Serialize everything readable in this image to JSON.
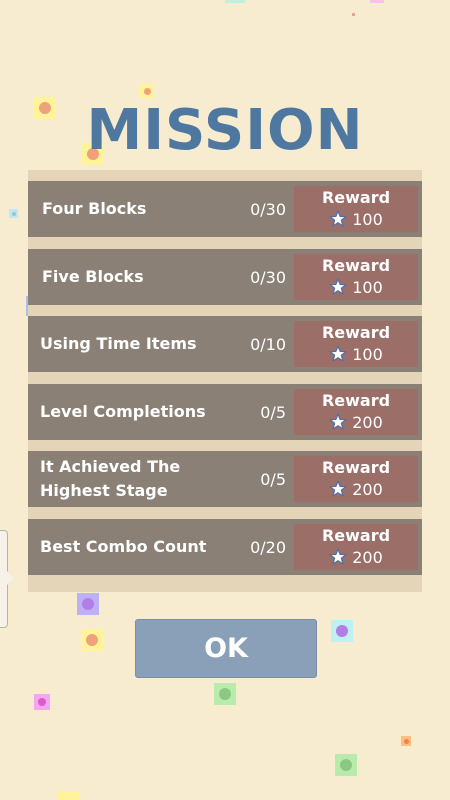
{
  "title": "MISSION",
  "missions": [
    {
      "name": "Four Blocks",
      "progress": "0/30",
      "reward_label": "Reward",
      "reward_amount": "100"
    },
    {
      "name": "Five Blocks",
      "progress": "0/30",
      "reward_label": "Reward",
      "reward_amount": "100"
    },
    {
      "name": "Using Time Items",
      "progress": "0/10",
      "reward_label": "Reward",
      "reward_amount": "100"
    },
    {
      "name": "Level Completions",
      "progress": "0/5",
      "reward_label": "Reward",
      "reward_amount": "200"
    },
    {
      "name": "It Achieved The Highest Stage",
      "progress": "0/5",
      "reward_label": "Reward",
      "reward_amount": "200"
    },
    {
      "name": "Best Combo Count",
      "progress": "0/20",
      "reward_label": "Reward",
      "reward_amount": "200"
    }
  ],
  "ok_label": "OK",
  "reward_icon": "star-icon",
  "colors": {
    "background": "#f8ecd0",
    "title": "#4f78a0",
    "panel": "#e4d5b9",
    "row": "#8b8076",
    "reward_button": "#9b6e68",
    "ok_button": "#8aa0b8"
  }
}
